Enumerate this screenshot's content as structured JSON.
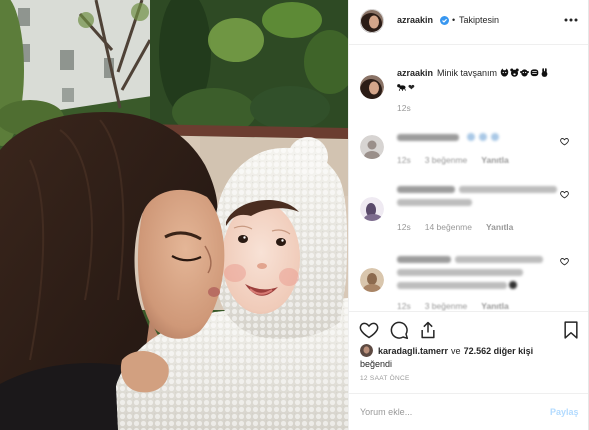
{
  "post": {
    "header": {
      "username": "azraakin",
      "separator": "•",
      "follow_status": "Takiptesin",
      "verified_icon": "verified-badge-icon",
      "more_icon": "more-options-icon"
    },
    "caption": {
      "username": "azraakin",
      "text": "Minik tavşanım",
      "emoji_icon": "animal-emoji-icon",
      "heart": "❤",
      "time": "12s"
    },
    "comments": [
      {
        "time": "12s",
        "likes": "3 beğenme",
        "reply": "Yanıtla"
      },
      {
        "time": "12s",
        "likes": "14 beğenme",
        "reply": "Yanıtla"
      },
      {
        "time": "12s",
        "likes": "3 beğenme",
        "reply": "Yanıtla"
      }
    ],
    "actions": {
      "like_icon": "heart-outline-icon",
      "comment_icon": "comment-bubble-icon",
      "share_icon": "share-upload-icon",
      "save_icon": "bookmark-icon"
    },
    "likes": {
      "user": "karadagli.tamerr",
      "connector": "ve",
      "others": "72.562 diğer kişi",
      "verb": "beğendi"
    },
    "timestamp": "12 SAAT ÖNCE",
    "comment_box": {
      "placeholder": "Yorum ekle...",
      "submit_label": "Paylaş"
    }
  },
  "colors": {
    "primary_text": "#262626",
    "muted_text": "#999999",
    "verified": "#3897f0",
    "submit_disabled": "#b3dbff",
    "divider": "#efefef"
  }
}
